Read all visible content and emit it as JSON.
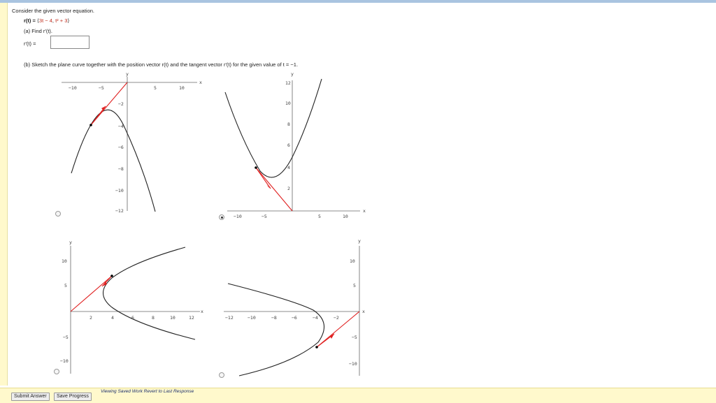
{
  "question": {
    "intro": "Consider the given vector equation.",
    "equation": {
      "lhs": "r(t) = ",
      "x_comp": "3t − 4",
      "y_comp": "t² + 3"
    },
    "part_a": {
      "label": "(a) Find r′(t).",
      "field_label": "r′(t) =",
      "value": ""
    },
    "part_b": {
      "label": "(b) Sketch the plane curve together with the position vector r(t) and the tangent vector r′(t) for the given value of t = −1."
    }
  },
  "options": [
    {
      "id": "A",
      "checked": false
    },
    {
      "id": "B",
      "checked": true
    },
    {
      "id": "C",
      "checked": false
    },
    {
      "id": "D",
      "checked": false
    }
  ],
  "graphs": {
    "A": {
      "xlabel": "x",
      "ylabel": "y",
      "xticks": [
        "−10",
        "−5",
        "5",
        "10"
      ],
      "yticks": [
        "−2",
        "−4",
        "−6",
        "−8",
        "−10",
        "−12"
      ]
    },
    "B": {
      "xlabel": "x",
      "ylabel": "y",
      "xticks": [
        "−10",
        "−5",
        "5",
        "10"
      ],
      "yticks": [
        "2",
        "4",
        "6",
        "8",
        "10",
        "12"
      ]
    },
    "C": {
      "xlabel": "x",
      "ylabel": "y",
      "xticks": [
        "2",
        "4",
        "6",
        "8",
        "10",
        "12"
      ],
      "yticks": [
        "10",
        "5",
        "−5",
        "−10"
      ]
    },
    "D": {
      "xlabel": "x",
      "ylabel": "y",
      "xticks": [
        "−12",
        "−10",
        "−8",
        "−6",
        "−4",
        "−2"
      ],
      "yticks": [
        "10",
        "5",
        "−5",
        "−10"
      ]
    }
  },
  "footer": {
    "submit": "Submit Answer",
    "save": "Save Progress",
    "viewing": "Viewing Saved Work",
    "revert": "Revert to Last Response"
  },
  "colors": {
    "vector": "#e02020",
    "curve": "#222222"
  }
}
